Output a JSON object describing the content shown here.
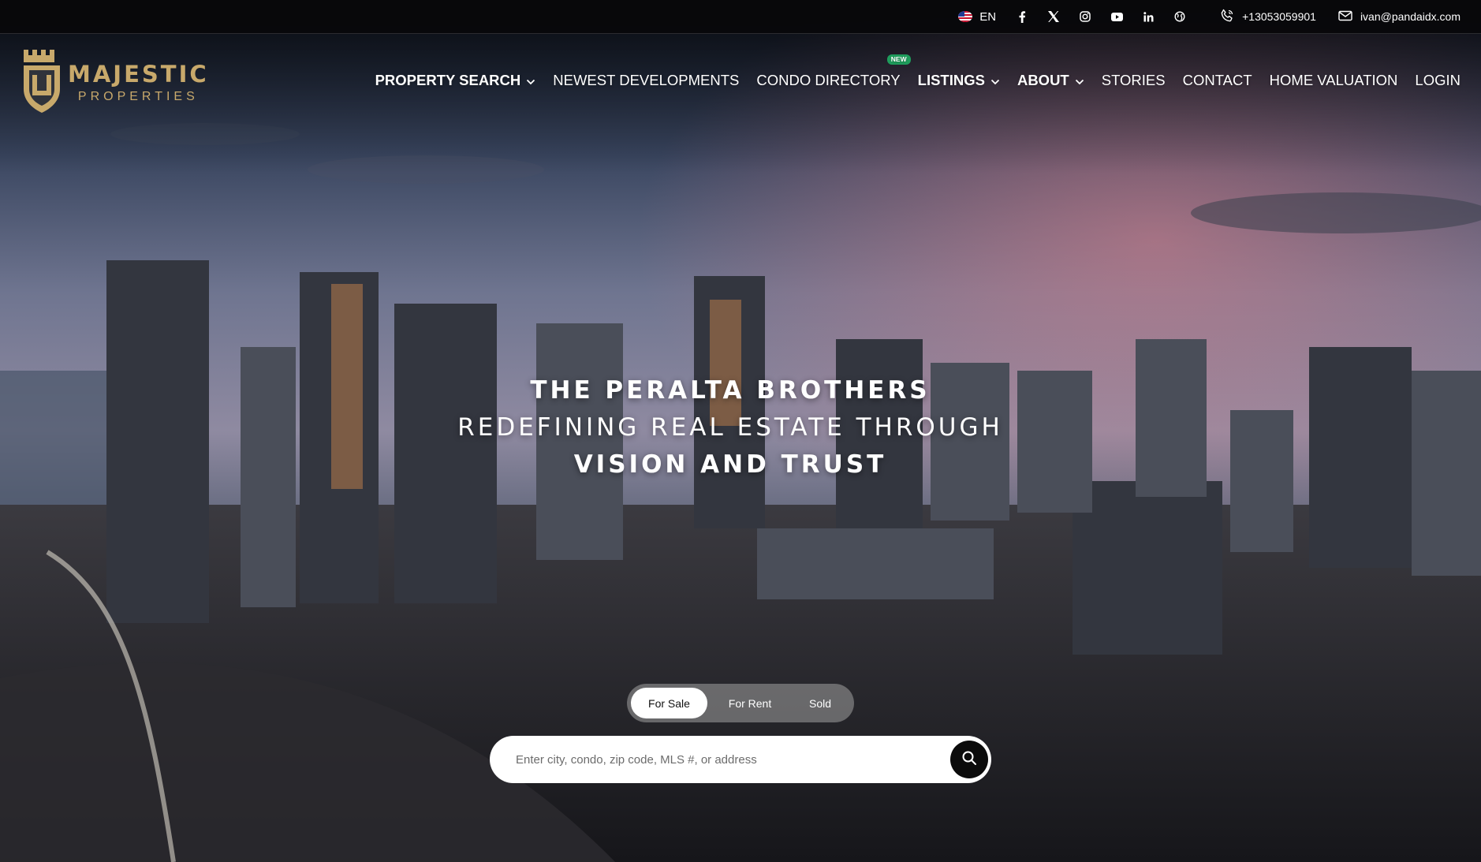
{
  "colors": {
    "accent_gold": "#c8a96b",
    "topbar_bg": "#08080a",
    "new_badge": "#1f9e5d",
    "search_button": "#0b0b0b"
  },
  "hero_background": "aerial photo of the Miami skyline at dusk",
  "topbar": {
    "language": {
      "icon": "us-flag-icon",
      "label": "EN"
    },
    "socials": [
      {
        "name": "facebook-icon"
      },
      {
        "name": "x-twitter-icon"
      },
      {
        "name": "instagram-icon"
      },
      {
        "name": "youtube-icon"
      },
      {
        "name": "linkedin-icon"
      },
      {
        "name": "globe-icon"
      }
    ],
    "phone": {
      "icon": "phone-icon",
      "label": "+13053059901"
    },
    "email": {
      "icon": "mail-icon",
      "label": "ivan@pandaidx.com"
    }
  },
  "logo": {
    "title": "MAJESTIC",
    "subtitle": "PROPERTIES"
  },
  "nav": {
    "items": [
      {
        "label": "PROPERTY SEARCH",
        "dropdown": true
      },
      {
        "label": "NEWEST DEVELOPMENTS"
      },
      {
        "label": "CONDO DIRECTORY",
        "badge": "NEW"
      },
      {
        "label": "LISTINGS",
        "dropdown": true
      },
      {
        "label": "ABOUT",
        "dropdown": true
      },
      {
        "label": "STORIES"
      },
      {
        "label": "CONTACT"
      },
      {
        "label": "HOME VALUATION"
      },
      {
        "label": "LOGIN"
      }
    ]
  },
  "hero": {
    "line1": "THE PERALTA BROTHERS",
    "line2": "REDEFINING REAL ESTATE THROUGH",
    "line3": "VISION AND TRUST"
  },
  "search": {
    "tabs": [
      "For Sale",
      "For Rent",
      "Sold"
    ],
    "active_tab": "For Sale",
    "placeholder": "Enter city, condo, zip code, MLS #, or address",
    "value": ""
  }
}
